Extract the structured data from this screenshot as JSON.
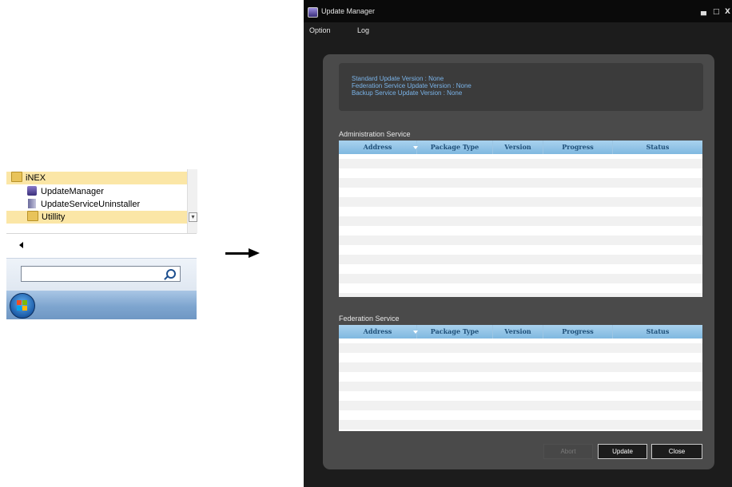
{
  "start_menu": {
    "items": [
      {
        "label": "iNEX",
        "icon": "folder-icon",
        "highlighted": true
      },
      {
        "label": "UpdateManager",
        "icon": "update-manager-icon",
        "highlighted": false
      },
      {
        "label": "UpdateServiceUninstaller",
        "icon": "uninstaller-icon",
        "highlighted": false
      },
      {
        "label": "Utillity",
        "icon": "folder-icon",
        "highlighted": true
      }
    ],
    "search_placeholder": ""
  },
  "window": {
    "title": "Update Manager",
    "minimize_glyph": "▄",
    "maximize_glyph": "□",
    "close_glyph": "X",
    "menu": [
      "Option",
      "Log"
    ],
    "info": [
      "Standard Update Version : None",
      "Federation Service Update Version : None",
      "Backup Service Update Version : None"
    ],
    "sections": [
      {
        "label": "Administration Service",
        "columns": [
          "Address",
          "Package Type",
          "Version",
          "Progress",
          "Status"
        ],
        "rows": []
      },
      {
        "label": "Federation Service",
        "columns": [
          "Address",
          "Package Type",
          "Version",
          "Progress",
          "Status"
        ],
        "rows": []
      }
    ],
    "buttons": {
      "abort": "Abort",
      "update": "Update",
      "close": "Close"
    }
  },
  "colors": {
    "window_bg": "#1c1c1c",
    "panel_bg": "#4a4a4a",
    "info_text": "#7ab3e8",
    "grid_header": "#8fc3e6",
    "start_menu_highlight": "#fbe6a6"
  }
}
